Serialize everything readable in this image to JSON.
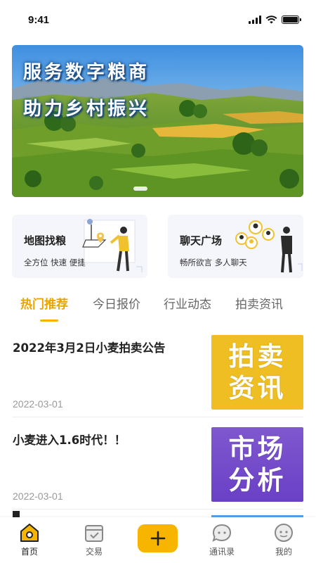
{
  "status_bar": {
    "time": "9:41"
  },
  "banner": {
    "line1": "服务数字粮商",
    "line2": "助力乡村振兴"
  },
  "features": [
    {
      "title": "地图找粮",
      "subtitle": "全方位 快速 便捷"
    },
    {
      "title": "聊天广场",
      "subtitle": "畅所欲言 多人聊天"
    }
  ],
  "tabs": [
    {
      "label": "热门推荐",
      "active": true
    },
    {
      "label": "今日报价",
      "active": false
    },
    {
      "label": "行业动态",
      "active": false
    },
    {
      "label": "拍卖资讯",
      "active": false
    }
  ],
  "news": [
    {
      "title": "2022年3月2日小麦拍卖公告",
      "date": "2022-03-01",
      "thumb_line1": "拍卖",
      "thumb_line2": "资讯",
      "thumb_color": "#efbe22"
    },
    {
      "title": "小麦进入1.6时代！！",
      "date": "2022-03-01",
      "thumb_line1": "市场",
      "thumb_line2": "分析",
      "thumb_color": "#7450ca"
    }
  ],
  "bottom_nav": [
    {
      "label": "首页",
      "icon": "home-icon",
      "active": true
    },
    {
      "label": "交易",
      "icon": "trade-box-icon",
      "active": false
    },
    {
      "label": "",
      "icon": "plus-icon",
      "active": false
    },
    {
      "label": "通讯录",
      "icon": "contacts-chat-icon",
      "active": false
    },
    {
      "label": "我的",
      "icon": "profile-face-icon",
      "active": false
    }
  ],
  "colors": {
    "accent": "#f5b400",
    "tab_active": "#e8a500",
    "date_gray": "#999999",
    "card_bg": "#f5f6fb"
  }
}
